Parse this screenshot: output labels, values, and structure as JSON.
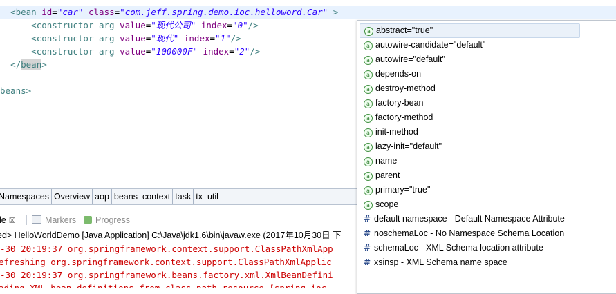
{
  "editor": {
    "lines": [
      {
        "indent": "  ",
        "open": "<",
        "tag": "bean",
        "attrs": [
          {
            "name": "id",
            "value": "\"car\""
          },
          {
            "name": "class",
            "value": "\"com.jeff.spring.demo.ioc.helloword.Car\""
          }
        ],
        "close": " >"
      },
      {
        "indent": "      ",
        "tag": "constructor-arg",
        "attrs": [
          {
            "name": "value",
            "value": "\"现代公司\""
          },
          {
            "name": "index",
            "value": "\"0\""
          }
        ],
        "close": "/>"
      },
      {
        "indent": "      ",
        "tag": "constructor-arg",
        "attrs": [
          {
            "name": "value",
            "value": "\"现代\""
          },
          {
            "name": "index",
            "value": "\"1\""
          }
        ],
        "close": "/>"
      },
      {
        "indent": "      ",
        "tag": "constructor-arg",
        "attrs": [
          {
            "name": "value",
            "value": "\"100000F\""
          },
          {
            "name": "index",
            "value": "\"2\""
          }
        ],
        "close": "/>"
      }
    ],
    "closing_bean": {
      "indent": "  ",
      "open": "</",
      "tag": "bean",
      "close": ">"
    },
    "closing_beans": {
      "text": "beans>"
    }
  },
  "editor_tabs": [
    "Namespaces",
    "Overview",
    "aop",
    "beans",
    "context",
    "task",
    "tx",
    "util"
  ],
  "console": {
    "tabs": [
      {
        "label": "ole",
        "close": "☒",
        "active": true
      },
      {
        "label": "Markers",
        "active": false
      },
      {
        "label": "Progress",
        "active": false
      }
    ],
    "terminated_text": "ed> HelloWorldDemo [Java Application] C:\\Java\\jdk1.6\\bin\\javaw.exe (2017年10月30日 下",
    "lines": [
      "-30 20:19:37 org.springframework.context.support.ClassPathXmlApp",
      "efreshing org.springframework.context.support.ClassPathXmlApplic",
      "-30 20:19:37 org.springframework.beans.factory.xml.XmlBeanDefini",
      "ading XML bean definitions from class path resource [spring-ioc"
    ]
  },
  "content_assist": {
    "items": [
      {
        "kind": "attribute",
        "icon": "attribute-icon",
        "label": "abstract=\"true\"",
        "selected": true
      },
      {
        "kind": "attribute",
        "icon": "attribute-icon",
        "label": "autowire-candidate=\"default\""
      },
      {
        "kind": "attribute",
        "icon": "attribute-icon",
        "label": "autowire=\"default\""
      },
      {
        "kind": "attribute",
        "icon": "attribute-icon",
        "label": "depends-on"
      },
      {
        "kind": "attribute",
        "icon": "attribute-icon",
        "label": "destroy-method"
      },
      {
        "kind": "attribute",
        "icon": "attribute-icon",
        "label": "factory-bean"
      },
      {
        "kind": "attribute",
        "icon": "attribute-icon",
        "label": "factory-method"
      },
      {
        "kind": "attribute",
        "icon": "attribute-icon",
        "label": "init-method"
      },
      {
        "kind": "attribute",
        "icon": "attribute-icon",
        "label": "lazy-init=\"default\""
      },
      {
        "kind": "attribute",
        "icon": "attribute-icon",
        "label": "name"
      },
      {
        "kind": "attribute",
        "icon": "attribute-icon",
        "label": "parent"
      },
      {
        "kind": "attribute",
        "icon": "attribute-icon",
        "label": "primary=\"true\""
      },
      {
        "kind": "attribute",
        "icon": "attribute-icon",
        "label": "scope"
      },
      {
        "kind": "namespace",
        "icon": "namespace-icon",
        "label": "default namespace - Default Namespace Attribute"
      },
      {
        "kind": "namespace",
        "icon": "namespace-icon",
        "label": "noschemaLoc - No Namespace Schema Location"
      },
      {
        "kind": "namespace",
        "icon": "namespace-icon",
        "label": "schemaLoc - XML Schema location attribute"
      },
      {
        "kind": "namespace",
        "icon": "namespace-icon",
        "label": "xsinsp - XML Schema name space"
      }
    ],
    "attribute_glyph": "a",
    "namespace_glyph": "#"
  },
  "colors": {
    "tag": "#3f7f7f",
    "attribute": "#7f007f",
    "value": "#2a00ff",
    "error": "#cc0000",
    "highlight": "#e8f2fe"
  }
}
